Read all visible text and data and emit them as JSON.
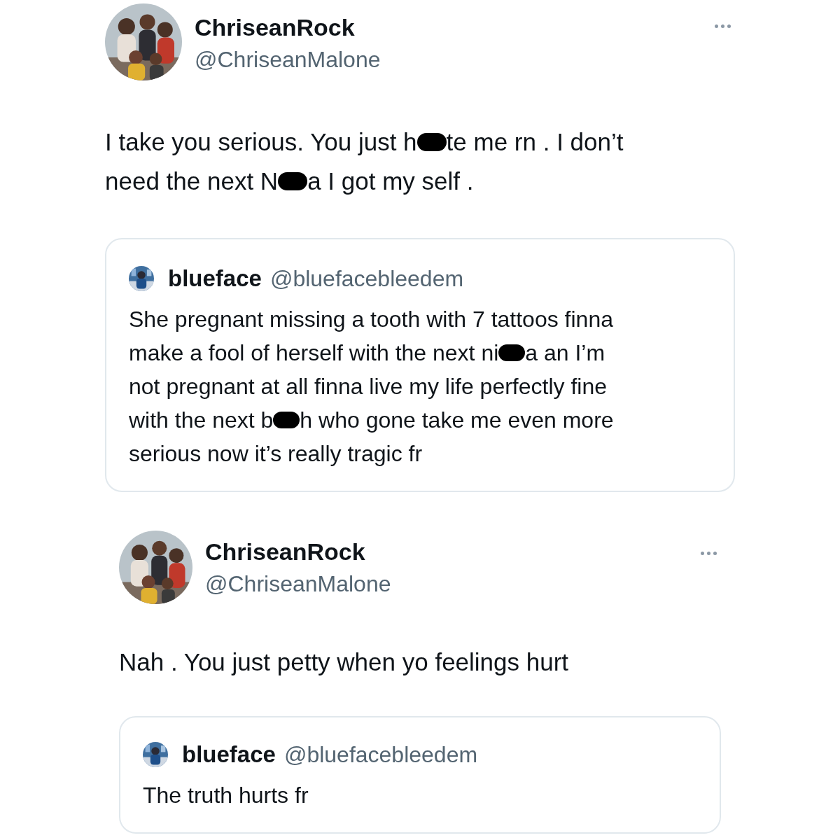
{
  "tweets": [
    {
      "name": "ChriseanRock",
      "handle": "@ChriseanMalone",
      "body_lines": [
        [
          {
            "kind": "text",
            "text": "I take you serious. You just h"
          },
          {
            "kind": "redaction"
          },
          {
            "kind": "text",
            "text": "te me rn . I don’t"
          }
        ],
        [
          {
            "kind": "text",
            "text": "need the next N"
          },
          {
            "kind": "redaction"
          },
          {
            "kind": "text",
            "text": "a I got my self ."
          }
        ]
      ],
      "quote": {
        "name": "blueface",
        "handle": "@bluefacebleedem",
        "body_lines": [
          [
            {
              "kind": "text",
              "text": "She pregnant missing a tooth with 7 tattoos finna"
            }
          ],
          [
            {
              "kind": "text",
              "text": "make a fool of herself with the next ni"
            },
            {
              "kind": "redaction"
            },
            {
              "kind": "text",
              "text": "a an I’m"
            }
          ],
          [
            {
              "kind": "text",
              "text": "not pregnant at all finna live my life perfectly fine"
            }
          ],
          [
            {
              "kind": "text",
              "text": "with the next b"
            },
            {
              "kind": "redaction"
            },
            {
              "kind": "text",
              "text": "h who gone take me even more"
            }
          ],
          [
            {
              "kind": "text",
              "text": "serious now it’s really tragic fr"
            }
          ]
        ]
      }
    },
    {
      "name": "ChriseanRock",
      "handle": "@ChriseanMalone",
      "body_lines": [
        [
          {
            "kind": "text",
            "text": "Nah . You just petty when yo feelings hurt"
          }
        ]
      ],
      "quote": {
        "name": "blueface",
        "handle": "@bluefacebleedem",
        "body_lines": [
          [
            {
              "kind": "text",
              "text": "The truth hurts fr"
            }
          ]
        ]
      }
    }
  ]
}
